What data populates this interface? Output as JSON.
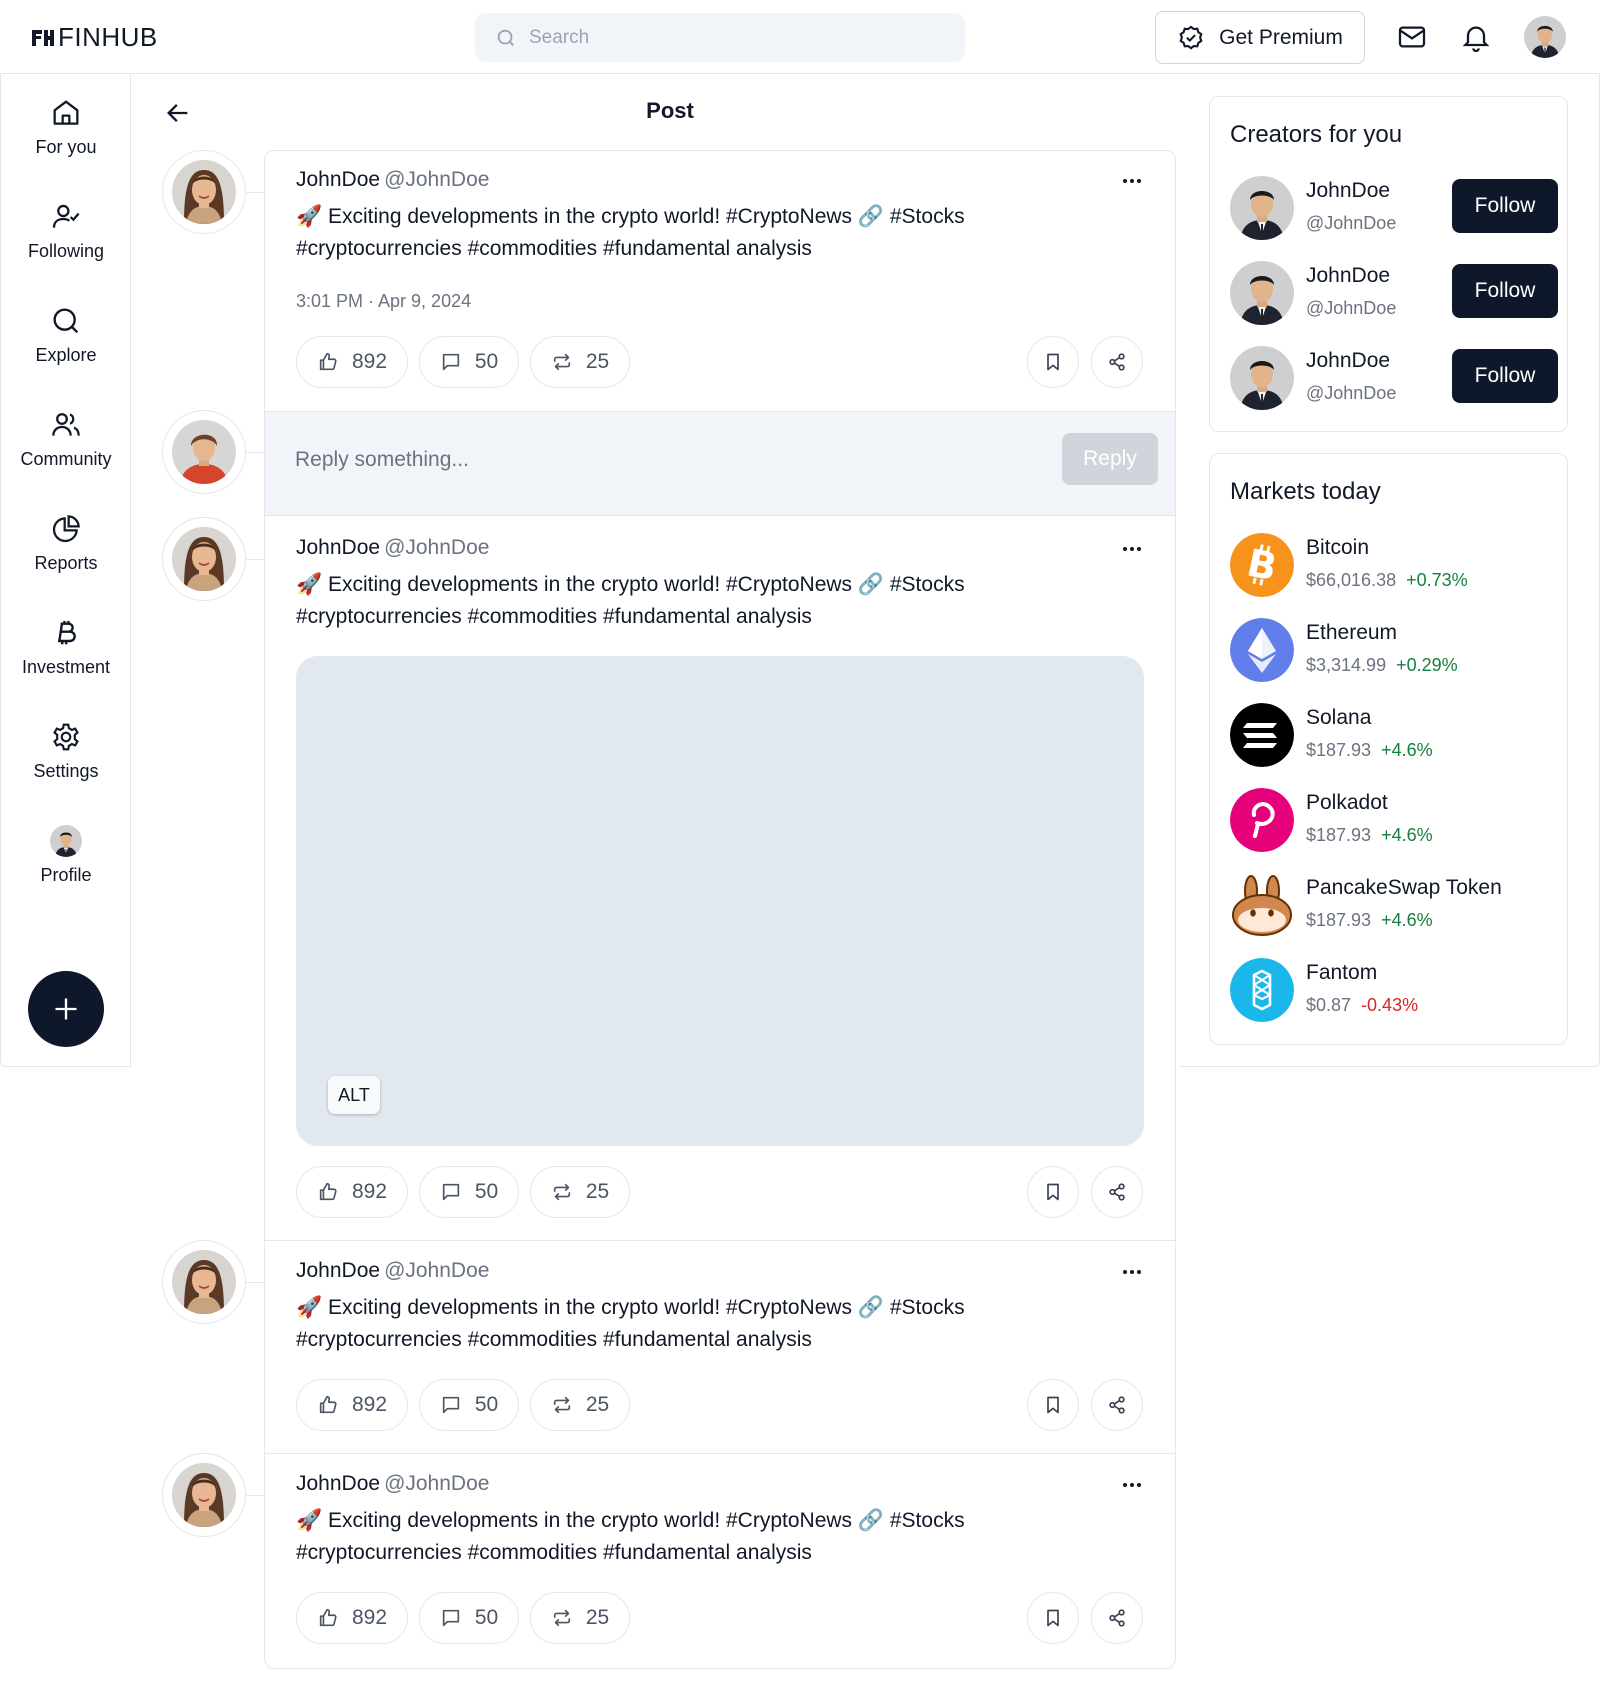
{
  "app": {
    "logo_text": "FINHUB"
  },
  "search": {
    "placeholder": "Search"
  },
  "topbar": {
    "premium_label": "Get Premium"
  },
  "sidebar": {
    "items": [
      {
        "label": "For you",
        "icon": "home-icon"
      },
      {
        "label": "Following",
        "icon": "user-check-icon"
      },
      {
        "label": "Explore",
        "icon": "search-icon"
      },
      {
        "label": "Community",
        "icon": "users-icon"
      },
      {
        "label": "Reports",
        "icon": "pie-chart-icon"
      },
      {
        "label": "Investment",
        "icon": "bitcoin-icon"
      },
      {
        "label": "Settings",
        "icon": "gear-icon"
      },
      {
        "label": "Profile",
        "icon": "avatar"
      }
    ],
    "fab_icon": "plus-icon"
  },
  "page": {
    "title": "Post"
  },
  "posts": [
    {
      "author": "JohnDoe",
      "handle": "@JohnDoe",
      "text_line1": "🚀 Exciting developments in the crypto world! #CryptoNews 🔗  #Stocks",
      "text_line2": "#cryptocurrencies #commodities #fundamental analysis",
      "timestamp": "3:01 PM · Apr 9, 2024",
      "likes": "892",
      "comments": "50",
      "reposts": "25"
    },
    {
      "author": "JohnDoe",
      "handle": "@JohnDoe",
      "text_line1": "🚀 Exciting developments in the crypto world! #CryptoNews 🔗  #Stocks",
      "text_line2": "#cryptocurrencies #commodities #fundamental analysis",
      "media_alt_label": "ALT",
      "likes": "892",
      "comments": "50",
      "reposts": "25"
    },
    {
      "author": "JohnDoe",
      "handle": "@JohnDoe",
      "text_line1": "🚀 Exciting developments in the crypto world! #CryptoNews 🔗  #Stocks",
      "text_line2": "#cryptocurrencies #commodities #fundamental analysis",
      "likes": "892",
      "comments": "50",
      "reposts": "25"
    },
    {
      "author": "JohnDoe",
      "handle": "@JohnDoe",
      "text_line1": "🚀 Exciting developments in the crypto world! #CryptoNews 🔗  #Stocks",
      "text_line2": "#cryptocurrencies #commodities #fundamental analysis",
      "likes": "892",
      "comments": "50",
      "reposts": "25"
    }
  ],
  "reply": {
    "placeholder": "Reply something...",
    "button_label": "Reply"
  },
  "creators": {
    "title": "Creators for you",
    "items": [
      {
        "name": "JohnDoe",
        "handle": "@JohnDoe",
        "button": "Follow"
      },
      {
        "name": "JohnDoe",
        "handle": "@JohnDoe",
        "button": "Follow"
      },
      {
        "name": "JohnDoe",
        "handle": "@JohnDoe",
        "button": "Follow"
      }
    ]
  },
  "markets": {
    "title": "Markets today",
    "items": [
      {
        "name": "Bitcoin",
        "price": "$66,016.38",
        "change": "+0.73%",
        "direction": "up",
        "icon": "bitcoin-logo",
        "color": "#f7931a"
      },
      {
        "name": "Ethereum",
        "price": "$3,314.99",
        "change": "+0.29%",
        "direction": "up",
        "icon": "ethereum-logo",
        "color": "#627eea"
      },
      {
        "name": "Solana",
        "price": "$187.93",
        "change": "+4.6%",
        "direction": "up",
        "icon": "solana-logo",
        "color": "#000000"
      },
      {
        "name": "Polkadot",
        "price": "$187.93",
        "change": "+4.6%",
        "direction": "up",
        "icon": "polkadot-logo",
        "color": "#e6007a"
      },
      {
        "name": "PancakeSwap Token",
        "price": "$187.93",
        "change": "+4.6%",
        "direction": "up",
        "icon": "pancakeswap-logo",
        "color": "#d1884f"
      },
      {
        "name": "Fantom",
        "price": "$0.87",
        "change": "-0.43%",
        "direction": "down",
        "icon": "fantom-logo",
        "color": "#1ab7ea"
      }
    ]
  },
  "colors": {
    "accent_dark": "#0f172a",
    "positive": "#15803d",
    "negative": "#dc2626",
    "surface": "#f1f5f9"
  }
}
